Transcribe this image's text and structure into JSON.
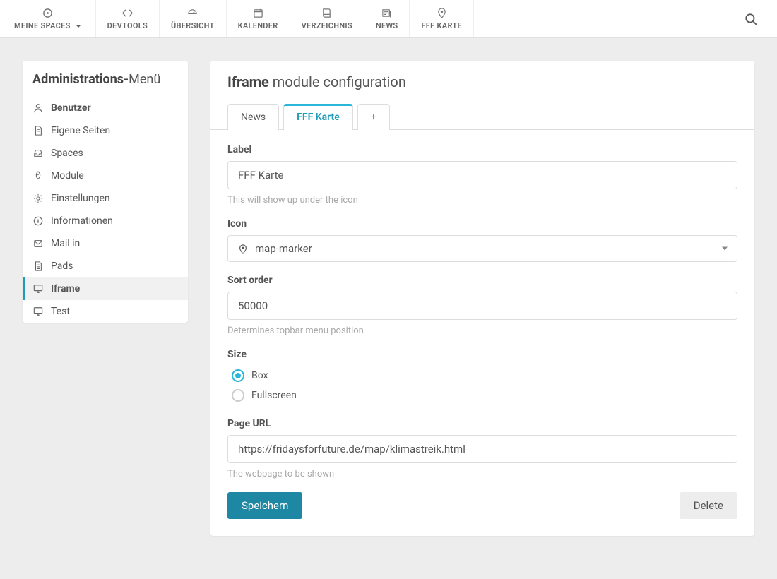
{
  "topbar": {
    "items": [
      {
        "label": "MEINE SPACES",
        "icon": "crosshair",
        "dropdown": true
      },
      {
        "label": "DEVTOOLS",
        "icon": "code"
      },
      {
        "label": "ÜBERSICHT",
        "icon": "dashboard"
      },
      {
        "label": "KALENDER",
        "icon": "calendar"
      },
      {
        "label": "VERZEICHNIS",
        "icon": "book"
      },
      {
        "label": "NEWS",
        "icon": "newspaper"
      },
      {
        "label": "FFF KARTE",
        "icon": "map-marker"
      }
    ]
  },
  "sidebar": {
    "title_bold": "Administrations-",
    "title_light": "Menü",
    "items": [
      {
        "label": "Benutzer",
        "icon": "user",
        "bold": true
      },
      {
        "label": "Eigene Seiten",
        "icon": "file"
      },
      {
        "label": "Spaces",
        "icon": "inbox"
      },
      {
        "label": "Module",
        "icon": "rocket"
      },
      {
        "label": "Einstellungen",
        "icon": "cogs"
      },
      {
        "label": "Informationen",
        "icon": "info"
      },
      {
        "label": "Mail in",
        "icon": "envelope"
      },
      {
        "label": "Pads",
        "icon": "file"
      },
      {
        "label": "Iframe",
        "icon": "desktop",
        "active": true
      },
      {
        "label": "Test",
        "icon": "desktop"
      }
    ]
  },
  "main": {
    "title_bold": "Iframe",
    "title_light": " module configuration",
    "tabs": [
      {
        "label": "News",
        "active": false
      },
      {
        "label": "FFF Karte",
        "active": true
      },
      {
        "label": "+",
        "active": false,
        "plus": true
      }
    ],
    "form": {
      "label_field": {
        "label": "Label",
        "value": "FFF Karte",
        "help": "This will show up under the icon"
      },
      "icon_field": {
        "label": "Icon",
        "value": "map-marker"
      },
      "sort_field": {
        "label": "Sort order",
        "value": "50000",
        "help": "Determines topbar menu position"
      },
      "size_field": {
        "label": "Size",
        "options": [
          "Box",
          "Fullscreen"
        ],
        "selected": "Box"
      },
      "url_field": {
        "label": "Page URL",
        "value": "https://fridaysforfuture.de/map/klimastreik.html",
        "help": "The webpage to be shown"
      },
      "save_label": "Speichern",
      "delete_label": "Delete"
    }
  }
}
